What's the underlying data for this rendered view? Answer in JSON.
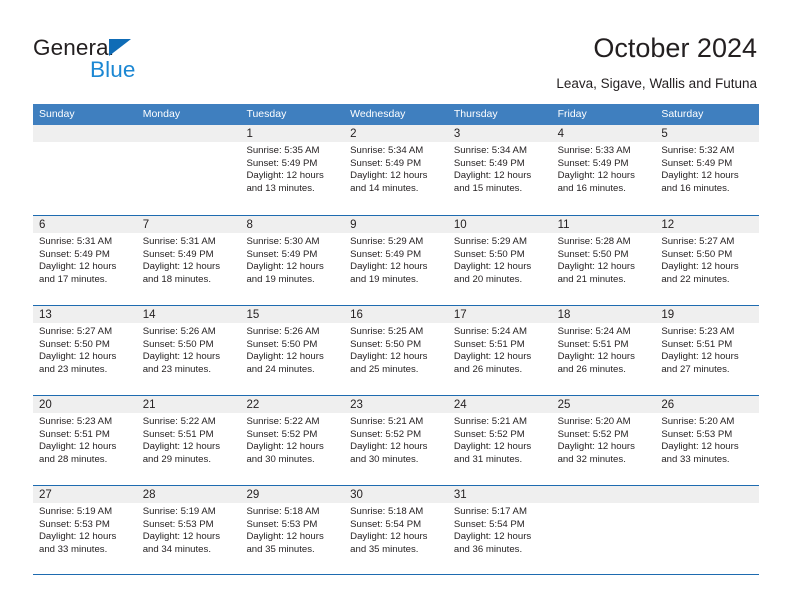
{
  "brand": {
    "name_part1": "General",
    "name_part2": "Blue",
    "primary_color": "#0f6cb6",
    "accent_color": "#1b87d3"
  },
  "header": {
    "title": "October 2024",
    "subtitle": "Leava, Sigave, Wallis and Futuna"
  },
  "calendar": {
    "header_bg": "#3f7fbf",
    "row_divider_color": "#1e6bb0",
    "day_band_color": "#efefef",
    "weekdays": [
      "Sunday",
      "Monday",
      "Tuesday",
      "Wednesday",
      "Thursday",
      "Friday",
      "Saturday"
    ],
    "weeks": [
      [
        {
          "day": "",
          "sunrise": "",
          "sunset": "",
          "daylight_line1": "",
          "daylight_line2": ""
        },
        {
          "day": "",
          "sunrise": "",
          "sunset": "",
          "daylight_line1": "",
          "daylight_line2": ""
        },
        {
          "day": "1",
          "sunrise": "Sunrise: 5:35 AM",
          "sunset": "Sunset: 5:49 PM",
          "daylight_line1": "Daylight: 12 hours",
          "daylight_line2": "and 13 minutes."
        },
        {
          "day": "2",
          "sunrise": "Sunrise: 5:34 AM",
          "sunset": "Sunset: 5:49 PM",
          "daylight_line1": "Daylight: 12 hours",
          "daylight_line2": "and 14 minutes."
        },
        {
          "day": "3",
          "sunrise": "Sunrise: 5:34 AM",
          "sunset": "Sunset: 5:49 PM",
          "daylight_line1": "Daylight: 12 hours",
          "daylight_line2": "and 15 minutes."
        },
        {
          "day": "4",
          "sunrise": "Sunrise: 5:33 AM",
          "sunset": "Sunset: 5:49 PM",
          "daylight_line1": "Daylight: 12 hours",
          "daylight_line2": "and 16 minutes."
        },
        {
          "day": "5",
          "sunrise": "Sunrise: 5:32 AM",
          "sunset": "Sunset: 5:49 PM",
          "daylight_line1": "Daylight: 12 hours",
          "daylight_line2": "and 16 minutes."
        }
      ],
      [
        {
          "day": "6",
          "sunrise": "Sunrise: 5:31 AM",
          "sunset": "Sunset: 5:49 PM",
          "daylight_line1": "Daylight: 12 hours",
          "daylight_line2": "and 17 minutes."
        },
        {
          "day": "7",
          "sunrise": "Sunrise: 5:31 AM",
          "sunset": "Sunset: 5:49 PM",
          "daylight_line1": "Daylight: 12 hours",
          "daylight_line2": "and 18 minutes."
        },
        {
          "day": "8",
          "sunrise": "Sunrise: 5:30 AM",
          "sunset": "Sunset: 5:49 PM",
          "daylight_line1": "Daylight: 12 hours",
          "daylight_line2": "and 19 minutes."
        },
        {
          "day": "9",
          "sunrise": "Sunrise: 5:29 AM",
          "sunset": "Sunset: 5:49 PM",
          "daylight_line1": "Daylight: 12 hours",
          "daylight_line2": "and 19 minutes."
        },
        {
          "day": "10",
          "sunrise": "Sunrise: 5:29 AM",
          "sunset": "Sunset: 5:50 PM",
          "daylight_line1": "Daylight: 12 hours",
          "daylight_line2": "and 20 minutes."
        },
        {
          "day": "11",
          "sunrise": "Sunrise: 5:28 AM",
          "sunset": "Sunset: 5:50 PM",
          "daylight_line1": "Daylight: 12 hours",
          "daylight_line2": "and 21 minutes."
        },
        {
          "day": "12",
          "sunrise": "Sunrise: 5:27 AM",
          "sunset": "Sunset: 5:50 PM",
          "daylight_line1": "Daylight: 12 hours",
          "daylight_line2": "and 22 minutes."
        }
      ],
      [
        {
          "day": "13",
          "sunrise": "Sunrise: 5:27 AM",
          "sunset": "Sunset: 5:50 PM",
          "daylight_line1": "Daylight: 12 hours",
          "daylight_line2": "and 23 minutes."
        },
        {
          "day": "14",
          "sunrise": "Sunrise: 5:26 AM",
          "sunset": "Sunset: 5:50 PM",
          "daylight_line1": "Daylight: 12 hours",
          "daylight_line2": "and 23 minutes."
        },
        {
          "day": "15",
          "sunrise": "Sunrise: 5:26 AM",
          "sunset": "Sunset: 5:50 PM",
          "daylight_line1": "Daylight: 12 hours",
          "daylight_line2": "and 24 minutes."
        },
        {
          "day": "16",
          "sunrise": "Sunrise: 5:25 AM",
          "sunset": "Sunset: 5:50 PM",
          "daylight_line1": "Daylight: 12 hours",
          "daylight_line2": "and 25 minutes."
        },
        {
          "day": "17",
          "sunrise": "Sunrise: 5:24 AM",
          "sunset": "Sunset: 5:51 PM",
          "daylight_line1": "Daylight: 12 hours",
          "daylight_line2": "and 26 minutes."
        },
        {
          "day": "18",
          "sunrise": "Sunrise: 5:24 AM",
          "sunset": "Sunset: 5:51 PM",
          "daylight_line1": "Daylight: 12 hours",
          "daylight_line2": "and 26 minutes."
        },
        {
          "day": "19",
          "sunrise": "Sunrise: 5:23 AM",
          "sunset": "Sunset: 5:51 PM",
          "daylight_line1": "Daylight: 12 hours",
          "daylight_line2": "and 27 minutes."
        }
      ],
      [
        {
          "day": "20",
          "sunrise": "Sunrise: 5:23 AM",
          "sunset": "Sunset: 5:51 PM",
          "daylight_line1": "Daylight: 12 hours",
          "daylight_line2": "and 28 minutes."
        },
        {
          "day": "21",
          "sunrise": "Sunrise: 5:22 AM",
          "sunset": "Sunset: 5:51 PM",
          "daylight_line1": "Daylight: 12 hours",
          "daylight_line2": "and 29 minutes."
        },
        {
          "day": "22",
          "sunrise": "Sunrise: 5:22 AM",
          "sunset": "Sunset: 5:52 PM",
          "daylight_line1": "Daylight: 12 hours",
          "daylight_line2": "and 30 minutes."
        },
        {
          "day": "23",
          "sunrise": "Sunrise: 5:21 AM",
          "sunset": "Sunset: 5:52 PM",
          "daylight_line1": "Daylight: 12 hours",
          "daylight_line2": "and 30 minutes."
        },
        {
          "day": "24",
          "sunrise": "Sunrise: 5:21 AM",
          "sunset": "Sunset: 5:52 PM",
          "daylight_line1": "Daylight: 12 hours",
          "daylight_line2": "and 31 minutes."
        },
        {
          "day": "25",
          "sunrise": "Sunrise: 5:20 AM",
          "sunset": "Sunset: 5:52 PM",
          "daylight_line1": "Daylight: 12 hours",
          "daylight_line2": "and 32 minutes."
        },
        {
          "day": "26",
          "sunrise": "Sunrise: 5:20 AM",
          "sunset": "Sunset: 5:53 PM",
          "daylight_line1": "Daylight: 12 hours",
          "daylight_line2": "and 33 minutes."
        }
      ],
      [
        {
          "day": "27",
          "sunrise": "Sunrise: 5:19 AM",
          "sunset": "Sunset: 5:53 PM",
          "daylight_line1": "Daylight: 12 hours",
          "daylight_line2": "and 33 minutes."
        },
        {
          "day": "28",
          "sunrise": "Sunrise: 5:19 AM",
          "sunset": "Sunset: 5:53 PM",
          "daylight_line1": "Daylight: 12 hours",
          "daylight_line2": "and 34 minutes."
        },
        {
          "day": "29",
          "sunrise": "Sunrise: 5:18 AM",
          "sunset": "Sunset: 5:53 PM",
          "daylight_line1": "Daylight: 12 hours",
          "daylight_line2": "and 35 minutes."
        },
        {
          "day": "30",
          "sunrise": "Sunrise: 5:18 AM",
          "sunset": "Sunset: 5:54 PM",
          "daylight_line1": "Daylight: 12 hours",
          "daylight_line2": "and 35 minutes."
        },
        {
          "day": "31",
          "sunrise": "Sunrise: 5:17 AM",
          "sunset": "Sunset: 5:54 PM",
          "daylight_line1": "Daylight: 12 hours",
          "daylight_line2": "and 36 minutes."
        },
        {
          "day": "",
          "sunrise": "",
          "sunset": "",
          "daylight_line1": "",
          "daylight_line2": ""
        },
        {
          "day": "",
          "sunrise": "",
          "sunset": "",
          "daylight_line1": "",
          "daylight_line2": ""
        }
      ]
    ]
  }
}
